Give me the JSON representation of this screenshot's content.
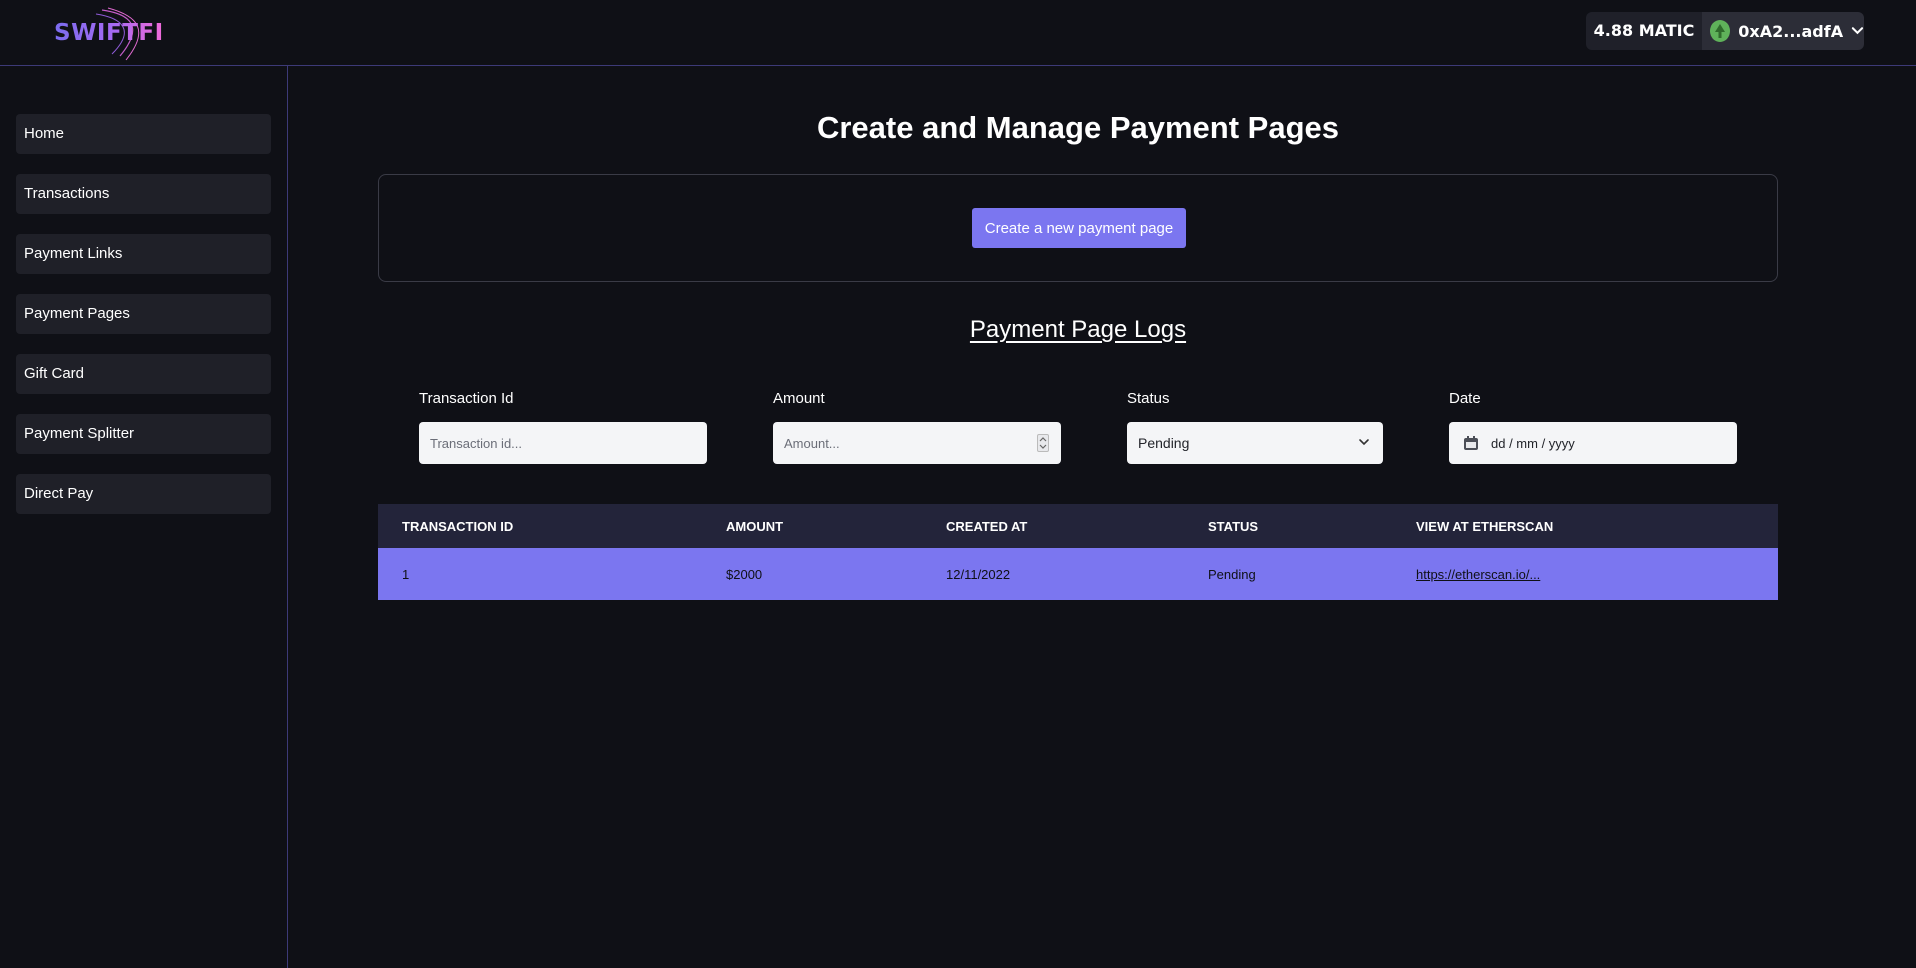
{
  "brand": {
    "name": "SWIFTFI"
  },
  "header": {
    "balance": "4.88 MATIC",
    "account": "0xA2...adfA",
    "avatar_color": "#5fb25a"
  },
  "sidebar": {
    "items": [
      {
        "label": "Home"
      },
      {
        "label": "Transactions"
      },
      {
        "label": "Payment Links"
      },
      {
        "label": "Payment Pages"
      },
      {
        "label": "Gift Card"
      },
      {
        "label": "Payment Splitter"
      },
      {
        "label": "Direct Pay"
      }
    ]
  },
  "main": {
    "title": "Create and Manage Payment Pages",
    "create_button": "Create a new payment page",
    "logs_title": "Payment Page Logs",
    "filters": {
      "transaction_id": {
        "label": "Transaction Id",
        "placeholder": "Transaction id..."
      },
      "amount": {
        "label": "Amount",
        "placeholder": "Amount..."
      },
      "status": {
        "label": "Status",
        "selected": "Pending"
      },
      "date": {
        "label": "Date",
        "placeholder": "dd / mm / yyyy"
      }
    },
    "table": {
      "headers": [
        "TRANSACTION ID",
        "AMOUNT",
        "CREATED AT",
        "STATUS",
        "VIEW AT ETHERSCAN"
      ],
      "rows": [
        {
          "id": "1",
          "amount": "$2000",
          "created_at": "12/11/2022",
          "status": "Pending",
          "link": "https://etherscan.io/..."
        }
      ]
    }
  },
  "colors": {
    "accent": "#7b76f0",
    "background": "#0f1016",
    "divider": "#3d3a78"
  }
}
